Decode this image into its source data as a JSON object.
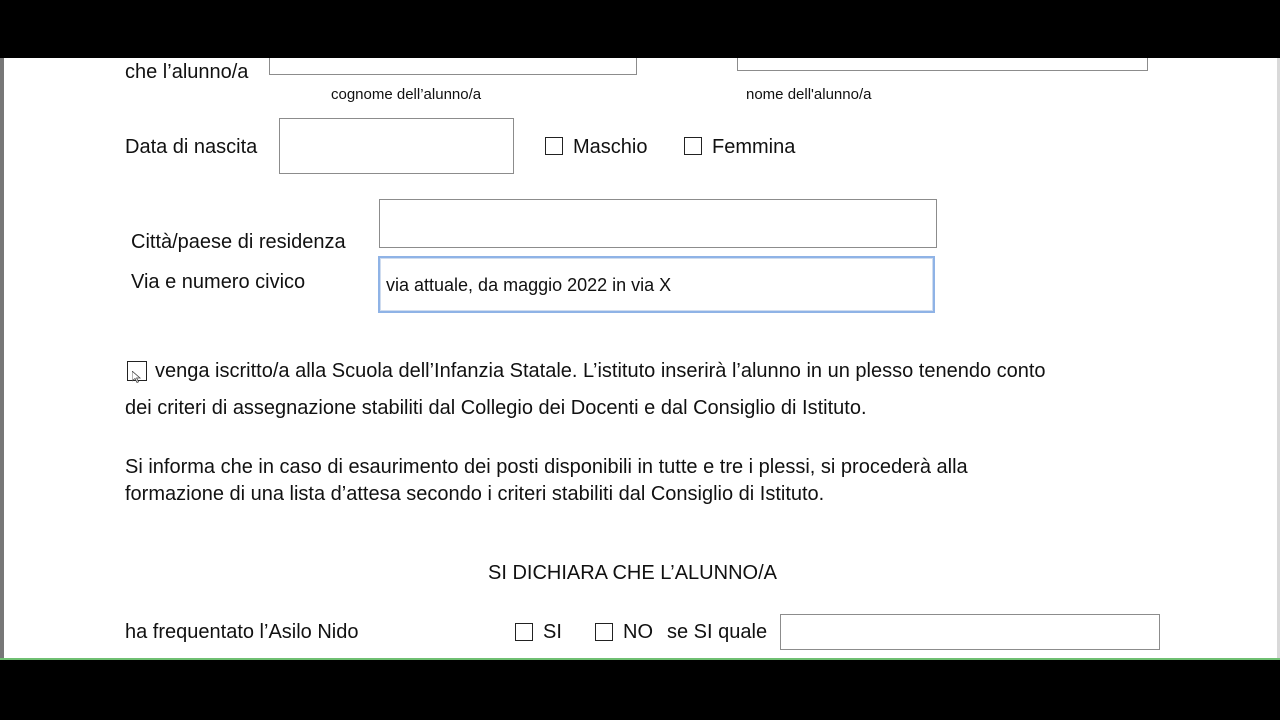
{
  "form": {
    "intro_prefix": "che l’alunno/a",
    "surname_caption": "cognome dell’alunno/a",
    "name_caption": "nome dell'alunno/a",
    "birth_label": "Data di nascita",
    "gender_male": "Maschio",
    "gender_female": "Femmina",
    "city_label": "Città/paese di residenza",
    "street_label": "Via e numero civico",
    "street_value": "via attuale, da maggio 2022 in via X",
    "enroll_line1": "venga iscritto/a  alla Scuola dell’Infanzia Statale. L’istituto inserirà l’alunno in un plesso tenendo conto",
    "enroll_line2": "dei criteri di assegnazione stabiliti dal Collegio dei Docenti e dal Consiglio di Istituto.",
    "info_line1": "Si informa che in caso di esaurimento dei posti disponibili in tutte e tre i plessi, si procederà alla",
    "info_line2": "formazione di una lista d’attesa secondo i criteri stabiliti dal Consiglio di Istituto.",
    "declaration_heading": "SI DICHIARA CHE L’ALUNNO/A",
    "nursery_label": "ha frequentato l’Asilo Nido",
    "yes_label": "SI",
    "no_label": "NO",
    "which_label": "se SI quale"
  }
}
